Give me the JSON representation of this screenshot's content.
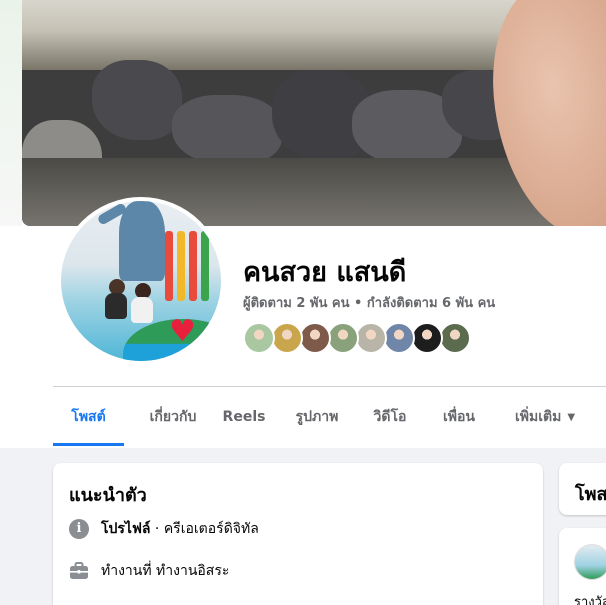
{
  "profile": {
    "name": "คนสวย แสนดี",
    "followers_line": "ผู้ติดตาม 2 พัน คน • กำลังติดตาม 6 พัน คน",
    "friend_avatars": [
      {
        "color": "#a9c7a0"
      },
      {
        "color": "#c9a64c"
      },
      {
        "color": "#7e5a4b"
      },
      {
        "color": "#8aa27c"
      },
      {
        "color": "#b9b4a8"
      },
      {
        "color": "#6f86a8"
      },
      {
        "color": "#1d1d1d"
      },
      {
        "color": "#5b6b4e"
      }
    ]
  },
  "tabs": [
    {
      "label": "โพสต์",
      "active": true
    },
    {
      "label": "เกี่ยวกับ",
      "active": false
    },
    {
      "label": "Reels",
      "active": false
    },
    {
      "label": "รูปภาพ",
      "active": false
    },
    {
      "label": "วิดีโอ",
      "active": false
    },
    {
      "label": "เพื่อน",
      "active": false
    },
    {
      "label": "เพิ่มเติม",
      "active": false
    }
  ],
  "intro": {
    "title": "แนะนำตัว",
    "profile_label": "โปรไฟล์",
    "profile_value": " · ครีเอเตอร์ดิจิทัล",
    "work": "ทำงานที่ ทำงานอิสระ"
  },
  "right": {
    "card_title": "โพส",
    "post_text": "รางวัล"
  },
  "colors": {
    "accent": "#1877f2",
    "text_secondary": "#65676b",
    "page_bg": "#f0f2f5"
  }
}
